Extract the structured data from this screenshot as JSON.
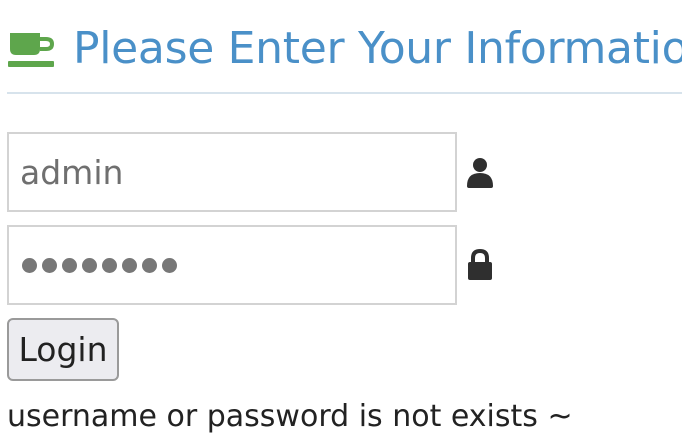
{
  "header": {
    "icon": "coffee-cup-icon",
    "title": "Please Enter Your Information",
    "title_color": "#4a90c8",
    "icon_color": "#5ea64c"
  },
  "form": {
    "username": {
      "value": "admin",
      "icon": "user-icon"
    },
    "password": {
      "masked_value": "••••••••",
      "icon": "lock-icon"
    },
    "login_label": "Login"
  },
  "message": {
    "text": "username or password is not exists ~"
  }
}
